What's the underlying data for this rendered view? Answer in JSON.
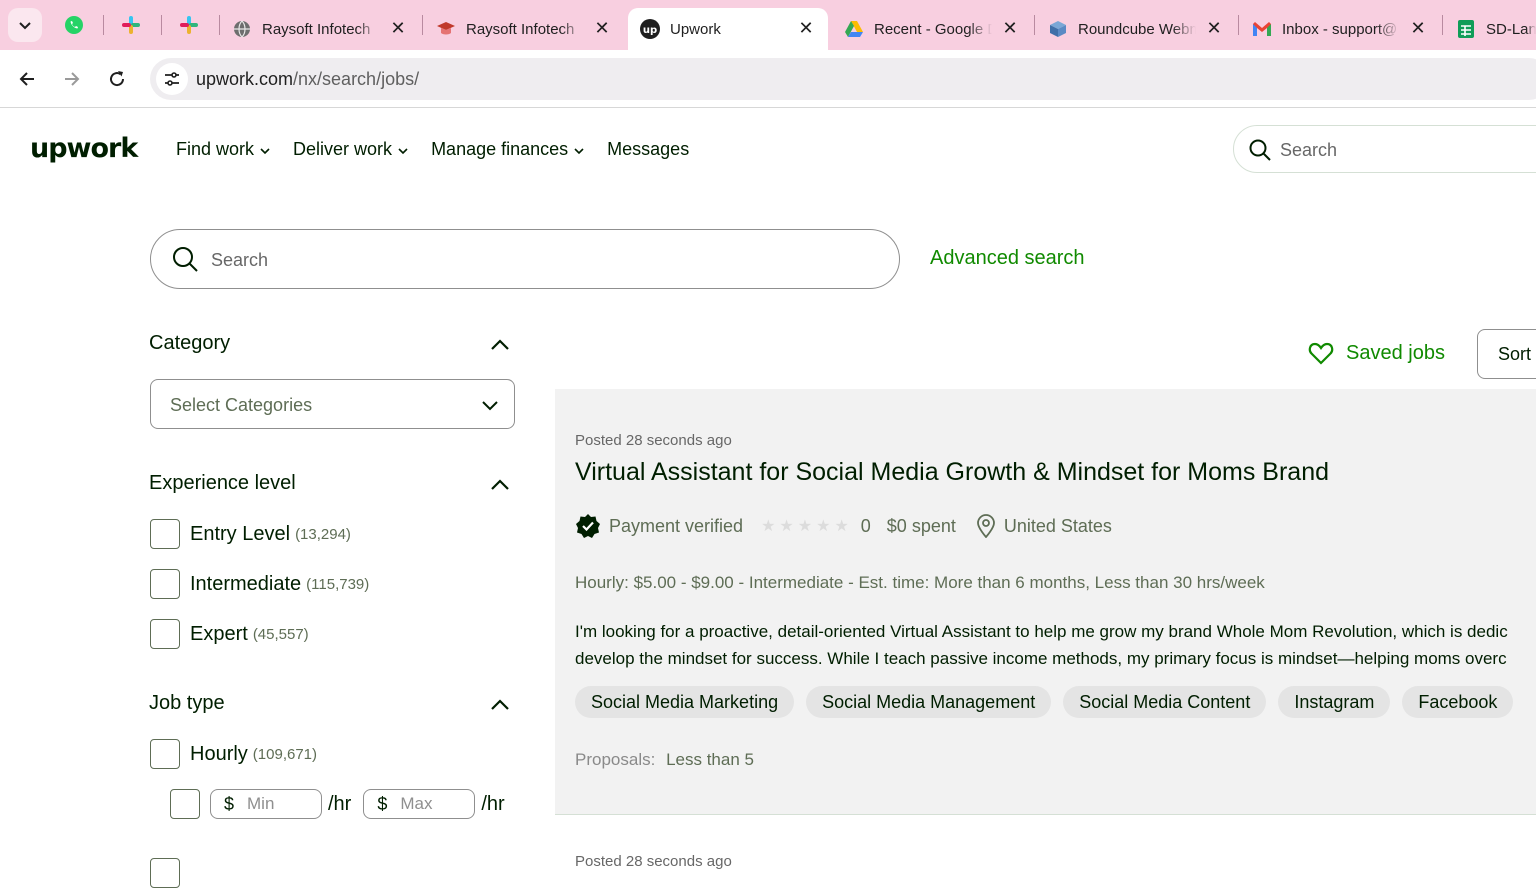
{
  "browser": {
    "tabs": [
      {
        "title": "Raysoft Infotech",
        "favicon": "globe-icon"
      },
      {
        "title": "Raysoft Infotech",
        "favicon": "graduation-cap-icon"
      },
      {
        "title": "Upwork",
        "favicon": "upwork-icon",
        "active": true
      },
      {
        "title": "Recent - Google Drive",
        "favicon": "google-drive-icon"
      },
      {
        "title": "Roundcube Webmail",
        "favicon": "roundcube-icon"
      },
      {
        "title": "Inbox - support@",
        "favicon": "gmail-icon"
      },
      {
        "title": "SD-Lane",
        "favicon": "google-sheets-icon"
      }
    ],
    "url_domain": "upwork.com",
    "url_path": "/nx/search/jobs/"
  },
  "header": {
    "logo": "upwork",
    "nav": [
      "Find work",
      "Deliver work",
      "Manage finances",
      "Messages"
    ],
    "search_placeholder": "Search"
  },
  "search": {
    "placeholder": "Search",
    "advanced_label": "Advanced search"
  },
  "filters": {
    "category": {
      "heading": "Category",
      "select_value": "Select Categories"
    },
    "experience": {
      "heading": "Experience level",
      "options": [
        {
          "label": "Entry Level",
          "count": "(13,294)"
        },
        {
          "label": "Intermediate",
          "count": "(115,739)"
        },
        {
          "label": "Expert",
          "count": "(45,557)"
        }
      ]
    },
    "job_type": {
      "heading": "Job type",
      "hourly_label": "Hourly",
      "hourly_count": "(109,671)",
      "currency": "$",
      "min_placeholder": "Min",
      "max_placeholder": "Max",
      "per_hour": "/hr"
    }
  },
  "results": {
    "saved_jobs_label": "Saved jobs",
    "sort_label": "Sort",
    "job": {
      "posted": "Posted 28 seconds ago",
      "title": "Virtual Assistant for Social Media Growth & Mindset for Moms Brand",
      "payment_status": "Payment verified",
      "rating": "0",
      "spent": "$0 spent",
      "location": "United States",
      "meta": "Hourly: $5.00 - $9.00 - Intermediate - Est. time: More than 6 months, Less than 30 hrs/week",
      "description_line1": "I'm looking for a proactive, detail-oriented Virtual Assistant to help me grow my brand Whole Mom Revolution, which is dedic",
      "description_line2": "develop the mindset for success. While I teach passive income methods, my primary focus is mindset—helping moms overc",
      "skills": [
        "Social Media Marketing",
        "Social Media Management",
        "Social Media Content",
        "Instagram",
        "Facebook"
      ],
      "proposals_label": "Proposals:",
      "proposals_value": "Less than 5"
    },
    "next_posted": "Posted 28 seconds ago"
  },
  "colors": {
    "brand_green": "#108a00",
    "tab_strip": "#f8cfe0",
    "card_bg": "#f2f2f2"
  }
}
